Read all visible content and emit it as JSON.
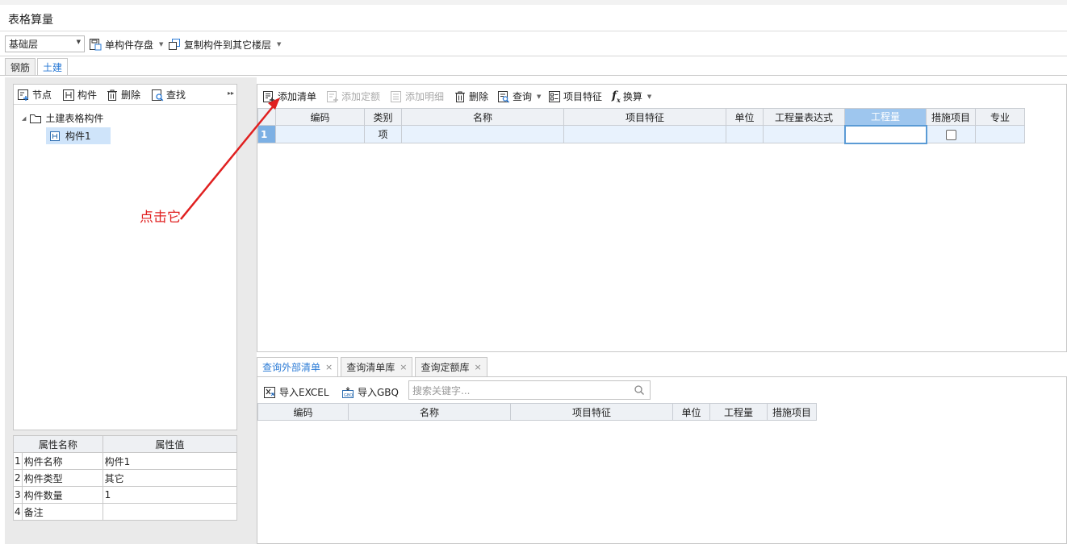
{
  "window": {
    "title": "表格算量"
  },
  "toolbar": {
    "floor_selected": "基础层",
    "save_component_label": "单构件存盘",
    "copy_component_label": "复制构件到其它楼层"
  },
  "main_tabs": [
    {
      "label": "钢筋"
    },
    {
      "label": "土建"
    }
  ],
  "left_panel": {
    "toolbar": {
      "node": "节点",
      "component": "构件",
      "delete": "删除",
      "find": "查找"
    },
    "tree": {
      "root_label": "土建表格构件",
      "child_label": "构件1"
    },
    "properties": {
      "headers": [
        "属性名称",
        "属性值"
      ],
      "rows": [
        {
          "num": "1",
          "name": "构件名称",
          "value": "构件1"
        },
        {
          "num": "2",
          "name": "构件类型",
          "value": "其它"
        },
        {
          "num": "3",
          "name": "构件数量",
          "value": "1"
        },
        {
          "num": "4",
          "name": "备注",
          "value": ""
        }
      ]
    }
  },
  "bill_toolbar": {
    "add_list": "添加清单",
    "add_quota": "添加定额",
    "add_detail": "添加明细",
    "delete": "删除",
    "query": "查询",
    "item_feature": "项目特征",
    "convert": "换算"
  },
  "bill_grid": {
    "headers": [
      "编码",
      "类别",
      "名称",
      "项目特征",
      "单位",
      "工程量表达式",
      "工程量",
      "措施项目",
      "专业"
    ],
    "rows": [
      {
        "num": "1",
        "code": "",
        "category": "项",
        "name": "",
        "feature": "",
        "unit": "",
        "expr": "",
        "qty": "",
        "measure": false,
        "major": ""
      }
    ]
  },
  "bottom_tabs": [
    {
      "label": "查询外部清单"
    },
    {
      "label": "查询清单库"
    },
    {
      "label": "查询定额库"
    }
  ],
  "bottom_toolbar": {
    "import_excel": "导入EXCEL",
    "import_gbq": "导入GBQ",
    "search_placeholder": "搜索关键字..."
  },
  "bottom_grid": {
    "headers": [
      "编码",
      "名称",
      "项目特征",
      "单位",
      "工程量",
      "措施项目"
    ]
  },
  "annotation": {
    "text": "点击它",
    "color": "#e02020"
  },
  "colors": {
    "accent": "#2b7bd6",
    "grid_header_highlight": "#9ec6ee",
    "row_number": "#7cb0e4",
    "selection": "#cfe4fa"
  }
}
